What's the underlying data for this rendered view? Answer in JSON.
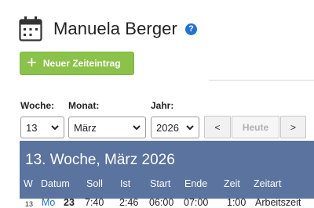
{
  "header": {
    "user_name": "Manuela Berger",
    "help_icon": "?"
  },
  "toolbar": {
    "new_entry_icon": "+",
    "new_entry_label": "Neuer Zeiteintrag"
  },
  "filters": {
    "week_label": "Woche:",
    "week_value": "13",
    "month_label": "Monat:",
    "month_value": "März",
    "year_label": "Jahr:",
    "year_value": "2026",
    "prev_label": "<",
    "today_label": "Heute",
    "next_label": ">"
  },
  "week": {
    "title": "13. Woche, März 2026",
    "columns": [
      "W",
      "Datum",
      "Soll",
      "Ist",
      "Start",
      "Ende",
      "Zeit",
      "Zeitart"
    ],
    "rows": [
      {
        "w": "13",
        "day": "Mo",
        "date": "23",
        "soll": "7:40",
        "ist": "2:46",
        "start": "06:00",
        "ende": "07:00",
        "zeit": "1:00",
        "zeitart": "Arbeitszeit"
      }
    ]
  },
  "colors": {
    "accent_green": "#8bc34a",
    "panel_blue": "#5a739f",
    "link_blue": "#1e73d8"
  }
}
